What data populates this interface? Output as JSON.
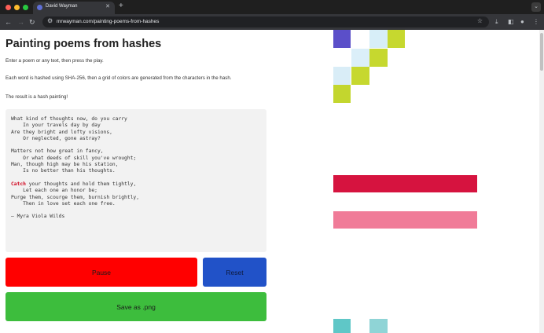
{
  "browser": {
    "tab_title": "David Wayman",
    "url": "mrwayman.com/painting-poems-from-hashes"
  },
  "page": {
    "title": "Painting poems from hashes",
    "intro": "Enter a poem or any text, then press the play.",
    "description": "Each word is hashed using SHA-256, then a grid of colors are generated from the characters in the hash.",
    "result": "The result is a hash painting!",
    "poem_before_highlight": "What kind of thoughts now, do you carry\n    In your travels day by day\nAre they bright and lofty visions,\n    Or neglected, gone astray?\n\nMatters not how great in fancy,\n    Or what deeds of skill you've wrought;\nMan, though high may be his station,\n    Is no better than his thoughts.\n\n",
    "poem_highlight": "Catch",
    "poem_after_highlight": " your thoughts and hold them tightly,\n    Let each one an honor be;\nPurge them, scourge them, burnish brightly,\n    Then in love set each one free.\n\n– Myra Viola Wilds",
    "pause_label": "Pause",
    "reset_label": "Reset",
    "save_label": "Save as .png"
  },
  "colors": {
    "pause": "#ff0000",
    "reset": "#2152c8",
    "save": "#3dbd3d",
    "highlight": "#d0021b"
  },
  "painting": {
    "grid_colors": [
      "#5b4fc9",
      "#d7eef8",
      "#c6d82f",
      "#dbeff9",
      "#c6d82f",
      "#d9edf7",
      "#c6d82f",
      "#c3d62e",
      "#d6133f",
      "#f07b98",
      "#5fc7c7"
    ]
  }
}
